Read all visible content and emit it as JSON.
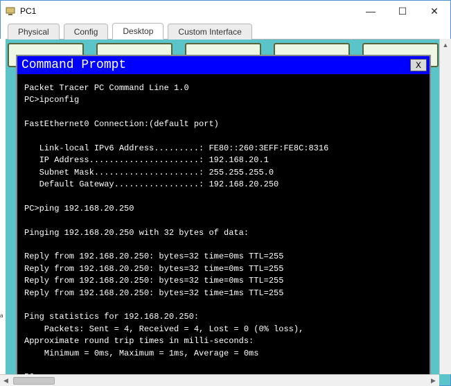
{
  "window": {
    "title": "PC1",
    "controls": {
      "min": "—",
      "max": "☐",
      "close": "✕"
    }
  },
  "tabs": [
    {
      "label": "Physical",
      "active": false
    },
    {
      "label": "Config",
      "active": false
    },
    {
      "label": "Desktop",
      "active": true
    },
    {
      "label": "Custom Interface",
      "active": false
    }
  ],
  "command_prompt": {
    "title": "Command Prompt",
    "close_label": "X",
    "lines": [
      "Packet Tracer PC Command Line 1.0",
      "PC>ipconfig",
      "",
      "FastEthernet0 Connection:(default port)",
      "",
      "   Link-local IPv6 Address.........: FE80::260:3EFF:FE8C:8316",
      "   IP Address......................: 192.168.20.1",
      "   Subnet Mask.....................: 255.255.255.0",
      "   Default Gateway.................: 192.168.20.250",
      "",
      "PC>ping 192.168.20.250",
      "",
      "Pinging 192.168.20.250 with 32 bytes of data:",
      "",
      "Reply from 192.168.20.250: bytes=32 time=0ms TTL=255",
      "Reply from 192.168.20.250: bytes=32 time=0ms TTL=255",
      "Reply from 192.168.20.250: bytes=32 time=0ms TTL=255",
      "Reply from 192.168.20.250: bytes=32 time=1ms TTL=255",
      "",
      "Ping statistics for 192.168.20.250:",
      "    Packets: Sent = 4, Received = 4, Lost = 0 (0% loss),",
      "Approximate round trip times in milli-seconds:",
      "    Minimum = 0ms, Maximum = 1ms, Average = 0ms",
      "",
      "PC>"
    ]
  },
  "sidebar_letter": "a"
}
